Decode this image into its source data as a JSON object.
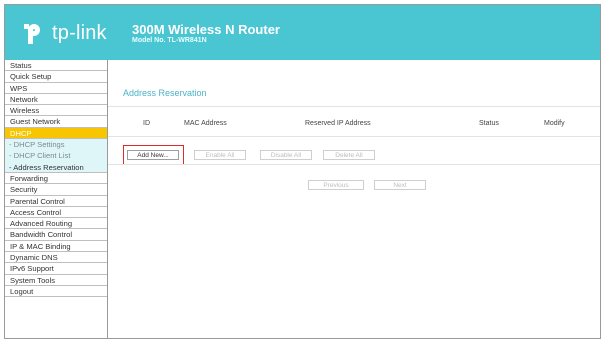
{
  "colors": {
    "header": "#4ac5d2",
    "active_nav": "#f7c600",
    "submenu_bg": "#dff6f9",
    "section_title": "#4ab3c7",
    "highlight": "#e02b2b"
  },
  "header": {
    "logo_icon": "tp-link-logo-icon",
    "logo_text": "tp-link",
    "title": "300M Wireless N Router",
    "model": "Model No. TL-WR841N"
  },
  "sidebar": {
    "items": [
      {
        "label": "Status"
      },
      {
        "label": "Quick Setup"
      },
      {
        "label": "WPS"
      },
      {
        "label": "Network"
      },
      {
        "label": "Wireless"
      },
      {
        "label": "Guest Network"
      },
      {
        "label": "DHCP",
        "active": true
      },
      {
        "label": "- DHCP Settings",
        "sub": true
      },
      {
        "label": "- DHCP Client List",
        "sub": true
      },
      {
        "label": "- Address Reservation",
        "sub": true,
        "current": true
      },
      {
        "label": "Forwarding"
      },
      {
        "label": "Security"
      },
      {
        "label": "Parental Control"
      },
      {
        "label": "Access Control"
      },
      {
        "label": "Advanced Routing"
      },
      {
        "label": "Bandwidth Control"
      },
      {
        "label": "IP & MAC Binding"
      },
      {
        "label": "Dynamic DNS"
      },
      {
        "label": "IPv6 Support"
      },
      {
        "label": "System Tools"
      },
      {
        "label": "Logout"
      }
    ]
  },
  "main": {
    "section_title": "Address Reservation",
    "table": {
      "headers": {
        "id": "ID",
        "mac": "MAC Address",
        "ip": "Reserved IP Address",
        "status": "Status",
        "modify": "Modify"
      }
    },
    "buttons": {
      "add_new": "Add New...",
      "enable_all": "Enable All",
      "disable_all": "Disable All",
      "delete_all": "Delete All",
      "previous": "Previous",
      "next": "Next"
    }
  }
}
